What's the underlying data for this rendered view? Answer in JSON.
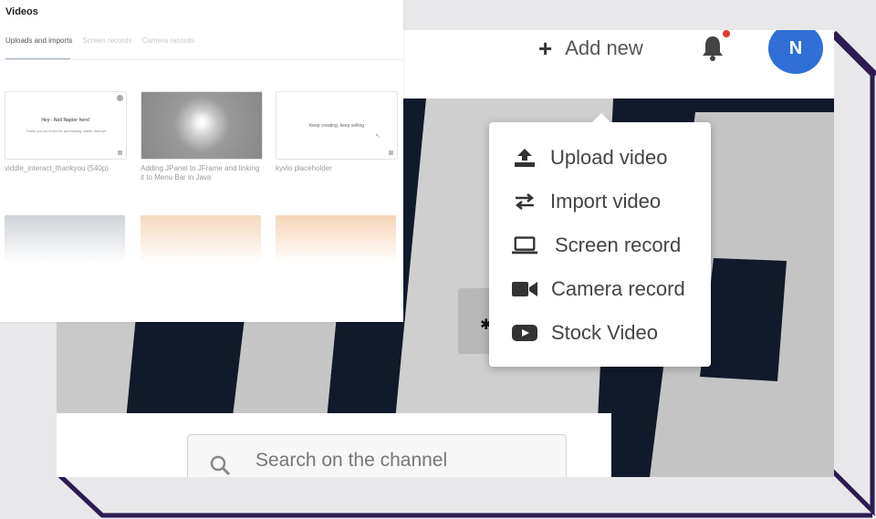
{
  "header": {
    "add_new_label": "Add new",
    "avatar_initial": "N"
  },
  "add_menu": {
    "items": [
      {
        "label": "Upload video",
        "icon": "upload-icon"
      },
      {
        "label": "Import video",
        "icon": "import-arrows-icon"
      },
      {
        "label": "Screen record",
        "icon": "laptop-icon"
      },
      {
        "label": "Camera record",
        "icon": "video-camera-icon"
      },
      {
        "label": "Stock Video",
        "icon": "youtube-play-icon"
      }
    ]
  },
  "search": {
    "placeholder": "Search on the channel"
  },
  "videos_panel": {
    "title": "Videos",
    "tabs": [
      {
        "label": "Uploads and imports",
        "active": true
      },
      {
        "label": "Screen records",
        "active": false
      },
      {
        "label": "Camera records",
        "active": false
      }
    ],
    "cards": [
      {
        "title": "viddle_interact_thankyou (540p)",
        "thumb_heading": "Hey - Neil Napier here!",
        "thumb_sub": "Thank you so much for purchasing Viddle Interact"
      },
      {
        "title": "Adding JPanel to JFrame and linking it to Menu Bar in Java",
        "thumb_heading": "",
        "thumb_sub": ""
      },
      {
        "title": "kyvio placeholder",
        "thumb_heading": "Keep creating, keep selling",
        "thumb_sub": ""
      }
    ]
  },
  "colors": {
    "accent_avatar": "#2f6fd6",
    "notification_dot": "#e53935",
    "frame_purple": "#2d1a52",
    "dark_navy": "#111a2b"
  }
}
